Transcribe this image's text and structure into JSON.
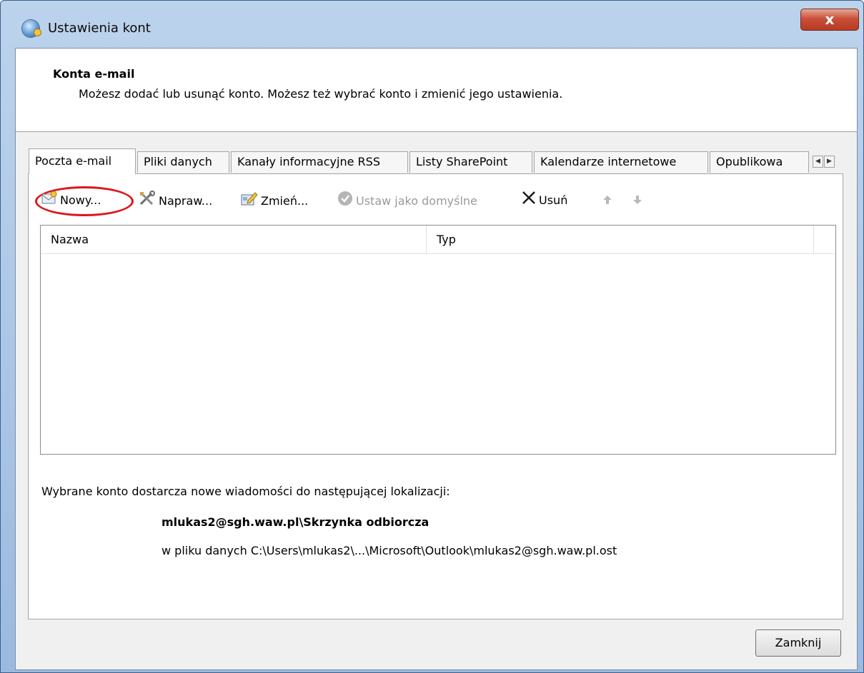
{
  "window": {
    "title": "Ustawienia kont",
    "close_glyph": "x"
  },
  "header": {
    "title": "Konta e-mail",
    "description": "Możesz dodać lub usunąć konto. Możesz też wybrać konto i zmienić jego ustawienia."
  },
  "tabs": [
    {
      "label": "Poczta e-mail",
      "active": true
    },
    {
      "label": "Pliki danych",
      "active": false
    },
    {
      "label": "Kanały informacyjne RSS",
      "active": false
    },
    {
      "label": "Listy SharePoint",
      "active": false
    },
    {
      "label": "Kalendarze internetowe",
      "active": false
    },
    {
      "label": "Opublikowa",
      "active": false
    }
  ],
  "toolbar": {
    "new_label": "Nowy...",
    "repair_label": "Napraw...",
    "change_label": "Zmień...",
    "set_default_label": "Ustaw jako domyślne",
    "remove_label": "Usuń"
  },
  "table": {
    "columns": [
      "Nazwa",
      "Typ"
    ],
    "rows": []
  },
  "location": {
    "label": "Wybrane konto dostarcza nowe wiadomości do następującej lokalizacji:",
    "folder": "mlukas2@sgh.waw.pl\\Skrzynka odbiorcza",
    "file": "w pliku danych C:\\Users\\mlukas2\\...\\Microsoft\\Outlook\\mlukas2@sgh.waw.pl.ost"
  },
  "footer": {
    "close_label": "Zamknij"
  },
  "colors": {
    "highlight": "#e0141c",
    "close_red": "#c9503a"
  }
}
